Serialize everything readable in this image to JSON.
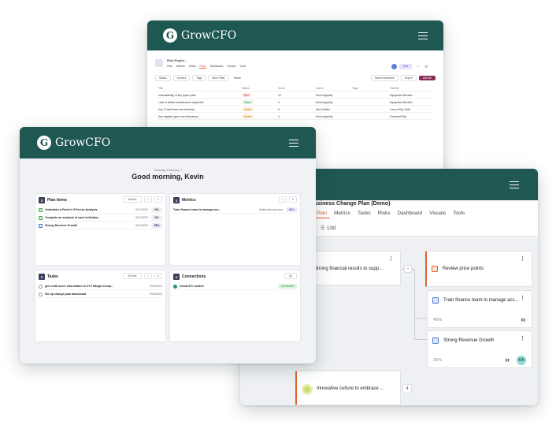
{
  "brand": {
    "name": "GrowCFO",
    "logo_letter": "G",
    "primary_color": "#1f5752",
    "accent_color": "#e0622b"
  },
  "risks_window": {
    "project": "Risk Regist...",
    "tabs": [
      "Plan",
      "Metrics",
      "Tasks",
      "Risks",
      "Dashboard",
      "Visuals",
      "Tools"
    ],
    "filters": [
      "Status",
      "Owners",
      "Tags",
      "More Filter",
      "Reset"
    ],
    "actions": [
      "Saved Searches",
      "Export",
      "Add Ne"
    ],
    "add_label": "Add",
    "columns": [
      "Title",
      "Status",
      "Score",
      "Owner",
      "Tags",
      "Parents"
    ],
    "rows": [
      {
        "title": "Unavailability of key spare parts",
        "status": "Red",
        "score": "12",
        "owner": "Kevin Appleby",
        "parent": "Equipment Breakd..."
      },
      {
        "title": "Lack of skilled maintenance engineers",
        "status": "Green",
        "score": "4",
        "owner": "Kevin Appleby",
        "parent": "Equipment Breakd..."
      },
      {
        "title": "Key IT staff leave the business",
        "status": "Amber",
        "score": "6",
        "owner": "Alex Smiths",
        "parent": "Loss of Key Staff"
      },
      {
        "title": "Key supplier goes out of business",
        "status": "Amber",
        "score": "4",
        "owner": "Kevin Appleby",
        "parent": "Financial Risk"
      }
    ]
  },
  "dashboard_window": {
    "date": "Tuesday, February 7",
    "greeting": "Good morning, Kevin",
    "plan_items": {
      "count": "3",
      "title": "Plan Items",
      "filter": "All time",
      "items": [
        {
          "label": "Undertake a Porter's 5 Forces Analysis",
          "date": "31/12/2023",
          "pct": "0%"
        },
        {
          "label": "Complete an analysis of each individua...",
          "date": "31/12/2023",
          "pct": "0%"
        },
        {
          "label": "Strong Revenue Growth",
          "date": "31/12/2023",
          "pct": "25%"
        }
      ]
    },
    "metrics": {
      "count": "1",
      "title": "Metrics",
      "items": [
        {
          "label": "Train finance team to manage acc...",
          "detail": "Update this tomorrow",
          "pct": "45%"
        }
      ]
    },
    "tasks": {
      "count": "2",
      "title": "Tasks",
      "filter": "All time",
      "items": [
        {
          "label": "get credit score information fo XYZ Widget Comp...",
          "date": "29/03/2023"
        },
        {
          "label": "Set up change plan dashboard",
          "date": "29/03/2023"
        }
      ]
    },
    "connections": {
      "count": "1",
      "title": "Connections",
      "filter": "All",
      "items": [
        {
          "label": "GrowCFO Limited",
          "status": "Connected"
        }
      ]
    }
  },
  "plan_window": {
    "title": "usiness Change Plan (Demo)",
    "tabs": [
      "Plan",
      "Metrics",
      "Tasks",
      "Risks",
      "Dashboard",
      "Visuals",
      "Tools"
    ],
    "view_label": "List",
    "nodes": {
      "left": "Strong financial results to supp...",
      "review": "Review price points",
      "train": {
        "label": "Train finance team to manage acc...",
        "pct": "45%"
      },
      "revenue": {
        "label": "Strong Revenue Growth",
        "pct": "25%",
        "avatar": "KA"
      },
      "culture": {
        "label": "Innovative culture to embrace ...",
        "count": "4"
      }
    }
  }
}
